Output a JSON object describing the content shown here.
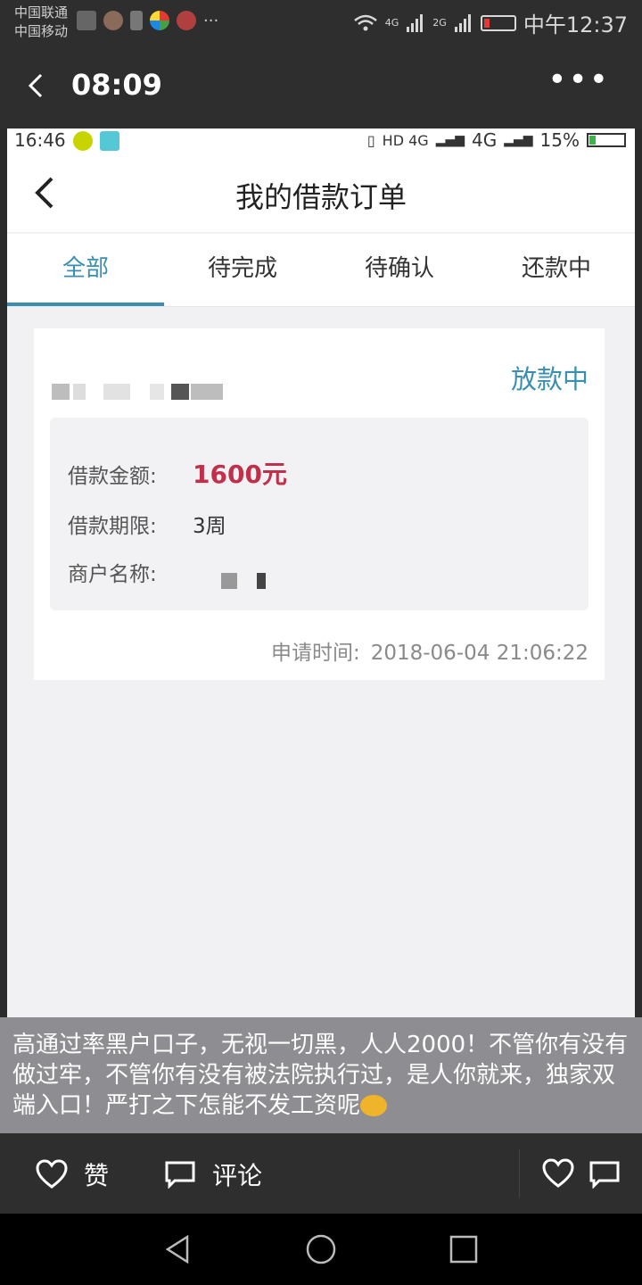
{
  "outer_status": {
    "carrier1": "中国联通",
    "carrier2": "中国移动",
    "signal1": "4G",
    "signal2": "2G",
    "time": "中午12:37"
  },
  "outer_header": {
    "title": "08:09",
    "more_icon": "more-icon"
  },
  "inner_status": {
    "time": "16:46",
    "network": "HD 4G",
    "network2": "4G",
    "battery": "15%"
  },
  "inner_header": {
    "title": "我的借款订单"
  },
  "tabs": [
    {
      "label": "全部",
      "active": true
    },
    {
      "label": "待完成",
      "active": false
    },
    {
      "label": "待确认",
      "active": false
    },
    {
      "label": "还款中",
      "active": false
    }
  ],
  "order": {
    "status": "放款中",
    "amount_label": "借款金额:",
    "amount_value": "1600元",
    "term_label": "借款期限:",
    "term_value": "3周",
    "merchant_label": "商户名称:",
    "apply_label": "申请时间:",
    "apply_time": "2018-06-04 21:06:22"
  },
  "caption": {
    "text": "高通过率黑户口子，无视一切黑，人人2000！不管你有没有做过牢，不管你有没有被法院执行过，是人你就来，独家双端入口！严打之下怎能不发工资呢"
  },
  "actions": {
    "like_label": "赞",
    "comment_label": "评论"
  },
  "colors": {
    "accent": "#3a8fb0",
    "amount": "#c0304a",
    "dark_bar": "#2e2e2e"
  }
}
